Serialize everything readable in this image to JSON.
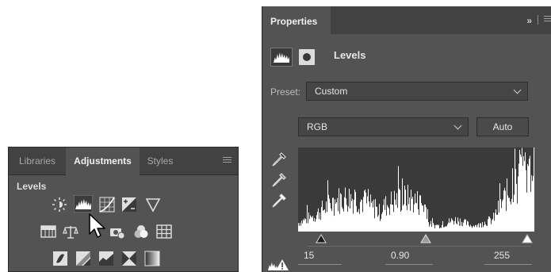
{
  "adjustments_panel": {
    "tabs": [
      "Libraries",
      "Adjustments",
      "Styles"
    ],
    "active_tab": "Adjustments",
    "heading": "Levels",
    "icons_row1": [
      "brightness-contrast-icon",
      "levels-icon",
      "curves-icon",
      "exposure-icon",
      "vibrance-icon"
    ],
    "icons_row2": [
      "hue-saturation-icon",
      "color-balance-icon",
      "black-white-icon",
      "photo-filter-icon",
      "channel-mixer-icon",
      "color-lookup-icon"
    ],
    "icons_row3": [
      "invert-icon",
      "posterize-icon",
      "threshold-icon",
      "selective-color-icon",
      "gradient-map-icon"
    ]
  },
  "properties_panel": {
    "tab_label": "Properties",
    "collapse_glyph": "»",
    "title": "Levels",
    "preset_label": "Preset:",
    "preset_value": "Custom",
    "channel_value": "RGB",
    "auto_label": "Auto",
    "input_black": "15",
    "input_gamma": "0.90",
    "input_white": "255"
  },
  "histogram": {
    "shadow_slider": 0.06,
    "midtone_slider": 0.53,
    "highlight_slider": 1.0
  },
  "colors": {
    "panel_bg": "#535353",
    "tabbar_bg": "#424242",
    "histogram_bg": "#3a3a3a",
    "histogram_fill": "#ffffff"
  }
}
